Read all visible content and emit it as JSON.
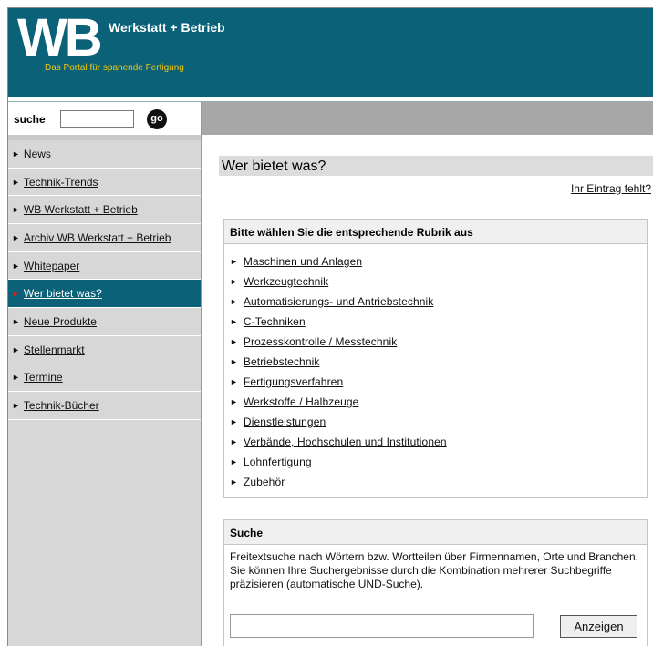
{
  "header": {
    "logo": "WB",
    "brand_name": "Werkstatt + Betrieb",
    "tagline": "Das Portal für spanende Fertigung"
  },
  "search": {
    "label": "suche",
    "value": "",
    "go_label": "go"
  },
  "sidebar": {
    "items": [
      {
        "label": "News",
        "active": false
      },
      {
        "label": "Technik-Trends",
        "active": false
      },
      {
        "label": "WB Werkstatt + Betrieb",
        "active": false
      },
      {
        "label": "Archiv WB Werkstatt + Betrieb",
        "active": false
      },
      {
        "label": "Whitepaper",
        "active": false
      },
      {
        "label": "Wer bietet was?",
        "active": true
      },
      {
        "label": "Neue Produkte",
        "active": false
      },
      {
        "label": "Stellenmarkt",
        "active": false
      },
      {
        "label": "Termine",
        "active": false
      },
      {
        "label": "Technik-Bücher",
        "active": false
      }
    ]
  },
  "main": {
    "title": "Wer bietet was?",
    "missing_entry_link": "Ihr Eintrag fehlt?",
    "rubrik_panel": {
      "heading": "Bitte wählen Sie die entsprechende Rubrik aus",
      "items": [
        "Maschinen und Anlagen",
        "Werkzeugtechnik",
        "Automatisierungs- und Antriebstechnik",
        "C-Techniken",
        "Prozesskontrolle / Messtechnik",
        "Betriebstechnik",
        "Fertigungsverfahren",
        "Werkstoffe / Halbzeuge",
        "Dienstleistungen",
        "Verbände, Hochschulen und Institutionen",
        "Lohnfertigung",
        "Zubehör"
      ]
    },
    "search_panel": {
      "heading": "Suche",
      "description": "Freitextsuche nach Wörtern bzw. Wortteilen über Firmennamen, Orte und Branchen. Sie können Ihre Suchergebnisse durch die Kombination mehrerer Suchbegriffe präzisieren (automatische UND-Suche).",
      "field_value": "",
      "button_label": "Anzeigen"
    }
  },
  "colors": {
    "header_bg": "#0b6178",
    "tagline": "#f2c80f",
    "sidebar_bg": "#d7d7d7",
    "active_nav_bg": "#0b6178",
    "active_marker": "#e01b1b",
    "strip_bg": "#a7a7a7"
  },
  "icons": {
    "nav_marker": "triangle-right-icon"
  }
}
